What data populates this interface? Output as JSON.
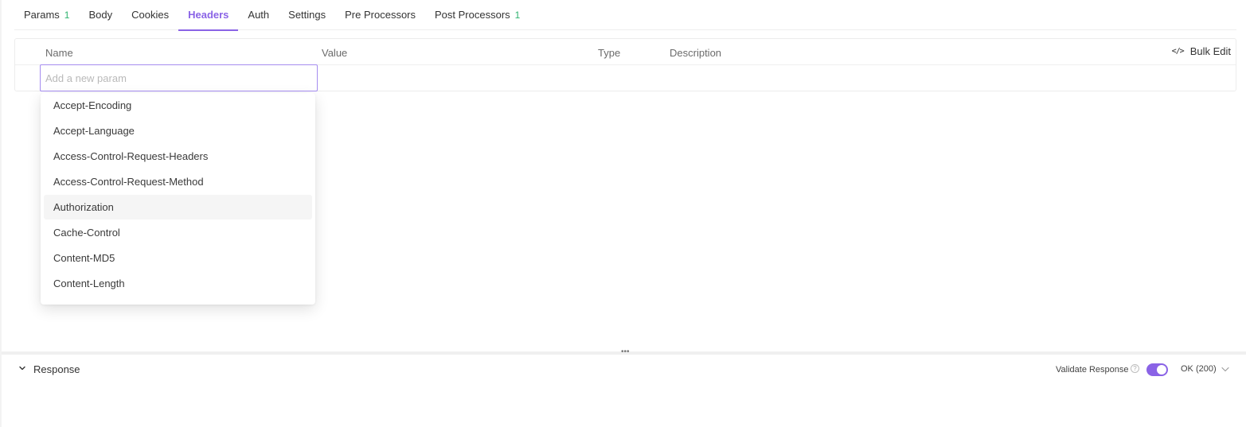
{
  "tabs": [
    {
      "label": "Params",
      "badge": "1"
    },
    {
      "label": "Body"
    },
    {
      "label": "Cookies"
    },
    {
      "label": "Headers",
      "active": true
    },
    {
      "label": "Auth"
    },
    {
      "label": "Settings"
    },
    {
      "label": "Pre Processors"
    },
    {
      "label": "Post Processors",
      "badge": "1"
    }
  ],
  "table": {
    "columns": {
      "name": "Name",
      "value": "Value",
      "type": "Type",
      "description": "Description"
    },
    "bulk_edit_label": "Bulk Edit",
    "input_placeholder": "Add a new param",
    "input_value": ""
  },
  "dropdown": {
    "options": [
      "Accept-Encoding",
      "Accept-Language",
      "Access-Control-Request-Headers",
      "Access-Control-Request-Method",
      "Authorization",
      "Cache-Control",
      "Content-MD5",
      "Content-Length"
    ],
    "highlighted": "Authorization"
  },
  "response": {
    "title": "Response",
    "validate_label": "Validate Response",
    "validate_enabled": true,
    "status": "OK (200)"
  },
  "colors": {
    "accent": "#8a63e6",
    "badge": "#2fb36f",
    "input_border": "#a58cf0"
  },
  "icons": {
    "bulk_edit": "code-icon",
    "collapse": "chevron-down-icon",
    "help": "question-circle-icon",
    "status_caret": "chevron-down-icon",
    "grip": "drag-handle-icon"
  }
}
